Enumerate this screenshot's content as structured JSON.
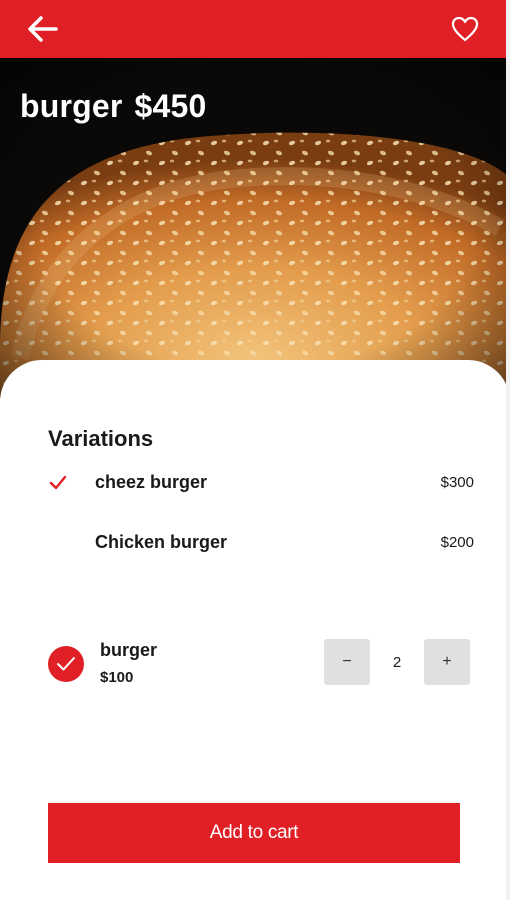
{
  "header": {
    "back_icon": "arrow-left-icon",
    "favorite_icon": "heart-icon",
    "background_color": "#e11f26"
  },
  "hero": {
    "image": "burger-bun-photo",
    "title": "burger",
    "price": "$450"
  },
  "variations": {
    "title": "Variations",
    "items": [
      {
        "name": "cheez burger",
        "price": "$300",
        "selected": true
      },
      {
        "name": "Chicken burger",
        "price": "$200",
        "selected": false
      }
    ]
  },
  "cart_item": {
    "name": "burger",
    "price": "$100",
    "quantity": "2",
    "minus_label": "−",
    "plus_label": "+",
    "selected": true
  },
  "actions": {
    "add_to_cart_label": "Add to cart"
  },
  "colors": {
    "accent": "#e11f26",
    "stepper_bg": "#e0e0e0"
  }
}
